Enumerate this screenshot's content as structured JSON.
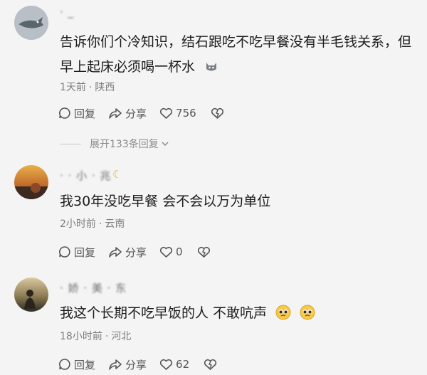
{
  "comments": [
    {
      "username": "· _",
      "text": "告诉你们个冷知识，结石跟吃不吃早餐没有半毛钱关系，但早上起床必须喝一杯水",
      "time": "1天前",
      "location": "陕西",
      "reply_label": "回复",
      "share_label": "分享",
      "likes": "756"
    },
    {
      "username": "· · 小 · 兆",
      "text": "我30年没吃早餐 会不会以万为单位",
      "time": "2小时前",
      "location": "云南",
      "reply_label": "回复",
      "share_label": "分享",
      "likes": "0"
    },
    {
      "username": "· 娇 · 美 · 东",
      "text": "我这个长期不吃早饭的人 不敢吭声",
      "time": "18小时前",
      "location": "河北",
      "reply_label": "回复",
      "share_label": "分享",
      "likes": "62"
    }
  ],
  "expand_replies": "展开133条回复",
  "meta_separator": "·",
  "colors": {
    "background": "#f4f4f4",
    "text": "#1b1b1b",
    "meta": "#7d7d7d",
    "moon": "#e7b83b"
  }
}
